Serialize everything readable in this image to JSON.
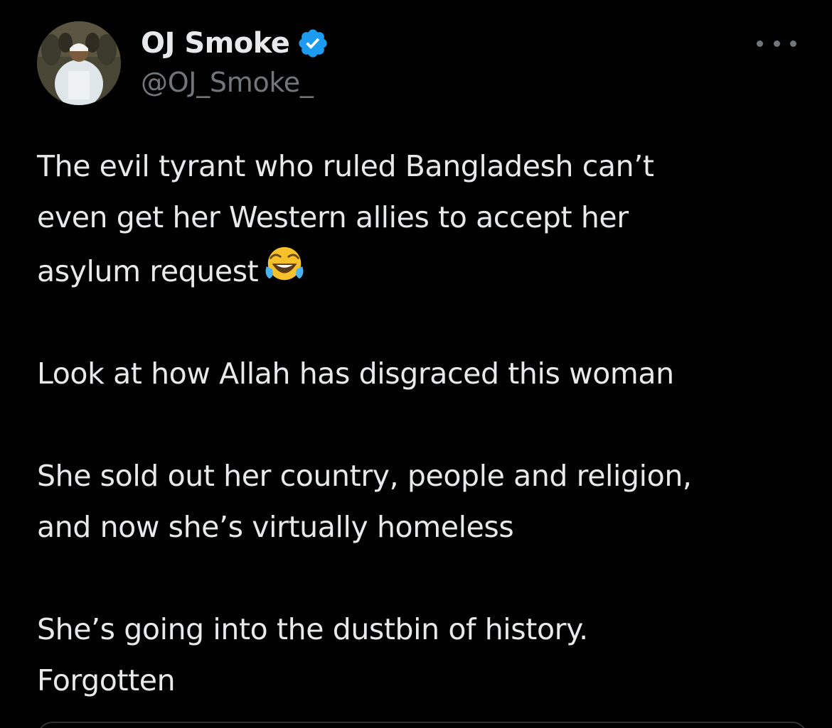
{
  "author": {
    "display_name": "OJ Smoke",
    "handle": "@OJ_Smoke_",
    "verified": true,
    "verified_icon": "verified-badge-icon",
    "avatar_icon": "profile-avatar"
  },
  "more_icon": "more-options-icon",
  "tweet": {
    "paragraphs": [
      [
        "The evil tyrant who ruled Bangladesh can’t",
        "even get her Western allies to accept her",
        "asylum request"
      ],
      [
        "Look at how Allah has disgraced this woman"
      ],
      [
        "She sold out her country, people and religion,",
        "and now she’s virtually homeless"
      ],
      [
        "She’s going into the dustbin of history.",
        "Forgotten"
      ]
    ],
    "emoji": "face-with-tears-of-joy"
  },
  "colors": {
    "background": "#000000",
    "text_primary": "#e7e9ea",
    "text_secondary": "#71767b",
    "verified_blue": "#1d9bf0"
  }
}
